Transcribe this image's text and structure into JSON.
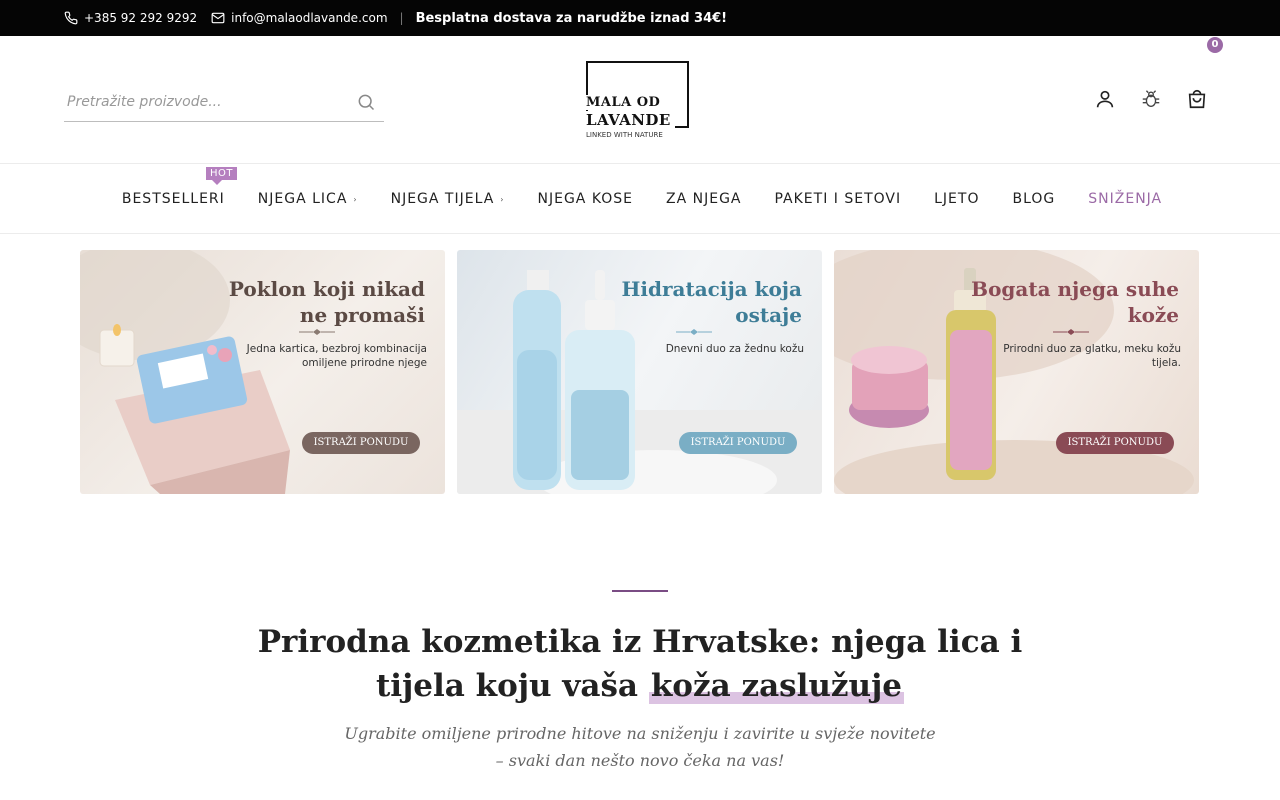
{
  "topbar": {
    "phone": "+385 92 292 9292",
    "email": "info@malaodlavande.com",
    "separator": "|",
    "promo": "Besplatna dostava za narudžbe iznad 34€!"
  },
  "header": {
    "search_placeholder": "Pretražite proizvode...",
    "logo": {
      "line1": "MALA OD",
      "line2": "LAVANDE",
      "tagline": "LINKED WITH NATURE"
    },
    "cart_count": "0",
    "icons": [
      "user-icon",
      "bug-icon",
      "cart-icon"
    ]
  },
  "nav": {
    "hot_badge": "HOT",
    "items": [
      {
        "label": "BESTSELLERI"
      },
      {
        "label": "NJEGA LICA",
        "chevron": "›"
      },
      {
        "label": "NJEGA TIJELA",
        "chevron": "›"
      },
      {
        "label": "NJEGA KOSE"
      },
      {
        "label": "ZA NJEGA"
      },
      {
        "label": "PAKETI I SETOVI"
      },
      {
        "label": "LJETO"
      },
      {
        "label": "BLOG"
      },
      {
        "label": "SNIŽENJA"
      }
    ],
    "sale_color": "#9b6aa6"
  },
  "banners": [
    {
      "title": "Poklon koji nikad ne promaši",
      "subtitle": "Jedna kartica, bezbroj kombinacija omiljene prirodne njege",
      "cta": "ISTRAŽI PONUDU"
    },
    {
      "title": "Hidratacija koja ostaje",
      "subtitle": "Dnevni duo za žednu kožu",
      "cta": "ISTRAŽI PONUDU"
    },
    {
      "title": "Bogata njega suhe kože",
      "subtitle": "Prirodni duo za glatku, meku kožu tijela.",
      "cta": "ISTRAŽI PONUDU"
    }
  ],
  "intro": {
    "headline_line1": "Prirodna kozmetika iz Hrvatske: njega lica i",
    "headline_line2_start": "tijela koju vaša",
    "headline_highlight": "koža zaslužuje",
    "text_line1": "Ugrabite omiljene prirodne hitove na sniženju i zavirite u svježe novitete",
    "text_line2": "– svaki dan nešto novo čeka na vas!"
  },
  "colors": {
    "accent": "#9b6aa6",
    "topbar": "#050505"
  }
}
